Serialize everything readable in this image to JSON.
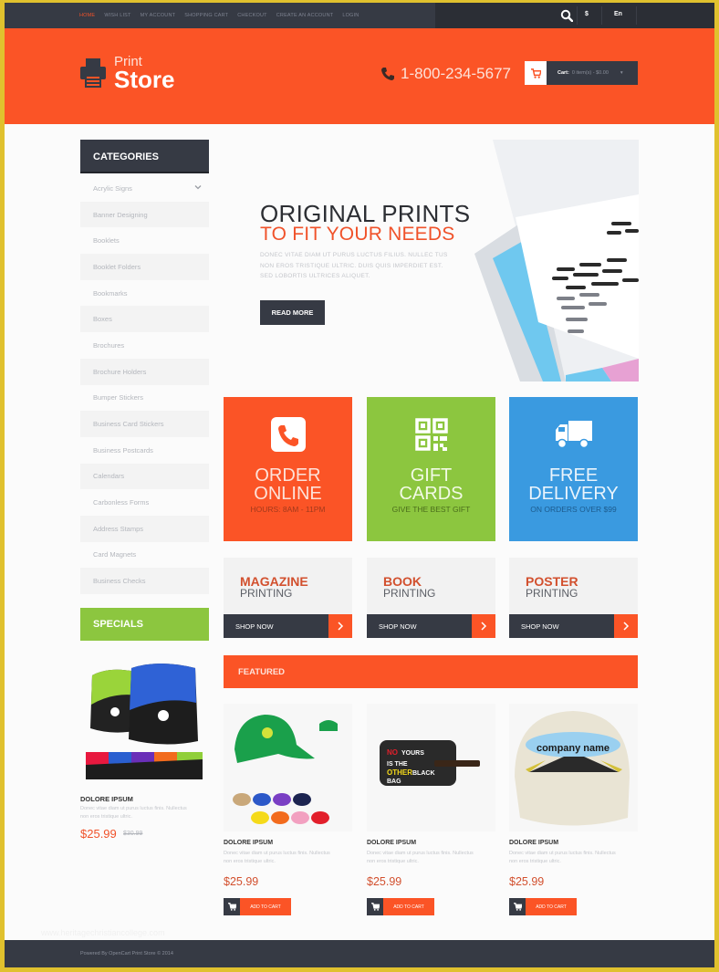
{
  "topbar": {
    "nav": [
      "Home",
      "Wish List",
      "My Account",
      "Shopping Cart",
      "Checkout",
      "Create an Account",
      "Login"
    ],
    "active_index": 0,
    "currency": "$",
    "language": "En"
  },
  "header": {
    "logo_line1": "Print",
    "logo_line2": "Store",
    "phone": "1-800-234-5677",
    "cart_label": "Cart:",
    "cart_summary": "0 item(s) - $0.00"
  },
  "sidebar": {
    "categories_title": "CATEGORIES",
    "categories": [
      "Acrylic Signs",
      "Banner Designing",
      "Booklets",
      "Booklet Folders",
      "Bookmarks",
      "Boxes",
      "Brochures",
      "Brochure Holders",
      "Bumper Stickers",
      "Business Card Stickers",
      "Business Postcards",
      "Calendars",
      "Carbonless Forms",
      "Address Stamps",
      "Card Magnets",
      "Business Checks"
    ],
    "specials_title": "SPECIALS",
    "special": {
      "name": "DOLORE IPSUM",
      "desc": "Donec vitae diam ut purus luctus finis. Nullectus non eros tristique ultric.",
      "price": "$25.99",
      "old_price": "$30.99"
    }
  },
  "hero": {
    "title": "ORIGINAL PRINTS",
    "subtitle": "TO FIT YOUR NEEDS",
    "desc": "DONEC VITAE DIAM UT PURUS LUCTUS FILIUS. NULLEC TUS NON EROS TRISTIQUE ULTRIC. DUIS QUIS IMPERDIET EST. SED LOBORTIS ULTRICES ALIQUET.",
    "button": "READ MORE"
  },
  "tiles": [
    {
      "line1": "ORDER",
      "line2": "ONLINE",
      "sub": "HOURS: 8AM - 11PM",
      "icon": "phone-icon"
    },
    {
      "line1": "GIFT",
      "line2": "CARDS",
      "sub": "GIVE THE BEST GIFT",
      "icon": "qr-code-icon"
    },
    {
      "line1": "FREE",
      "line2": "DELIVERY",
      "sub": "ON ORDERS OVER $99",
      "icon": "truck-icon"
    }
  ],
  "printing": [
    {
      "title": "MAGAZINE",
      "sub": "PRINTING",
      "button": "SHOP NOW"
    },
    {
      "title": "BOOK",
      "sub": "PRINTING",
      "button": "SHOP NOW"
    },
    {
      "title": "POSTER",
      "sub": "PRINTING",
      "button": "SHOP NOW"
    }
  ],
  "featured": {
    "title": "FEATURED",
    "products": [
      {
        "name": "DOLORE IPSUM",
        "desc": "Donec vitae diam ut purus luctus finis. Nullectus non eros tristique ultric.",
        "price": "$25.99",
        "button": "ADD TO CART",
        "image": "green cap"
      },
      {
        "name": "DOLORE IPSUM",
        "desc": "Donec vitae diam ut purus luctus finis. Nullectus non eros tristique ultric.",
        "price": "$25.99",
        "button": "ADD TO CART",
        "image": "luggage tag"
      },
      {
        "name": "DOLORE IPSUM",
        "desc": "Donec vitae diam ut purus luctus finis. Nullectus non eros tristique ultric.",
        "price": "$25.99",
        "button": "ADD TO CART",
        "image": "company name cap",
        "image_text": "company name"
      }
    ]
  },
  "tag_text": [
    "NO",
    "YOURS",
    "IS THE",
    "OTHER",
    "BLACK",
    "BAG"
  ],
  "footer": {
    "faint": "www.heritagechristiancollege.com",
    "text": "Powered By OpenCart Print Store © 2014"
  },
  "colors": {
    "accent": "#fb5426",
    "dark": "#363a44",
    "green": "#8cc63f",
    "blue": "#3a9ae0"
  }
}
